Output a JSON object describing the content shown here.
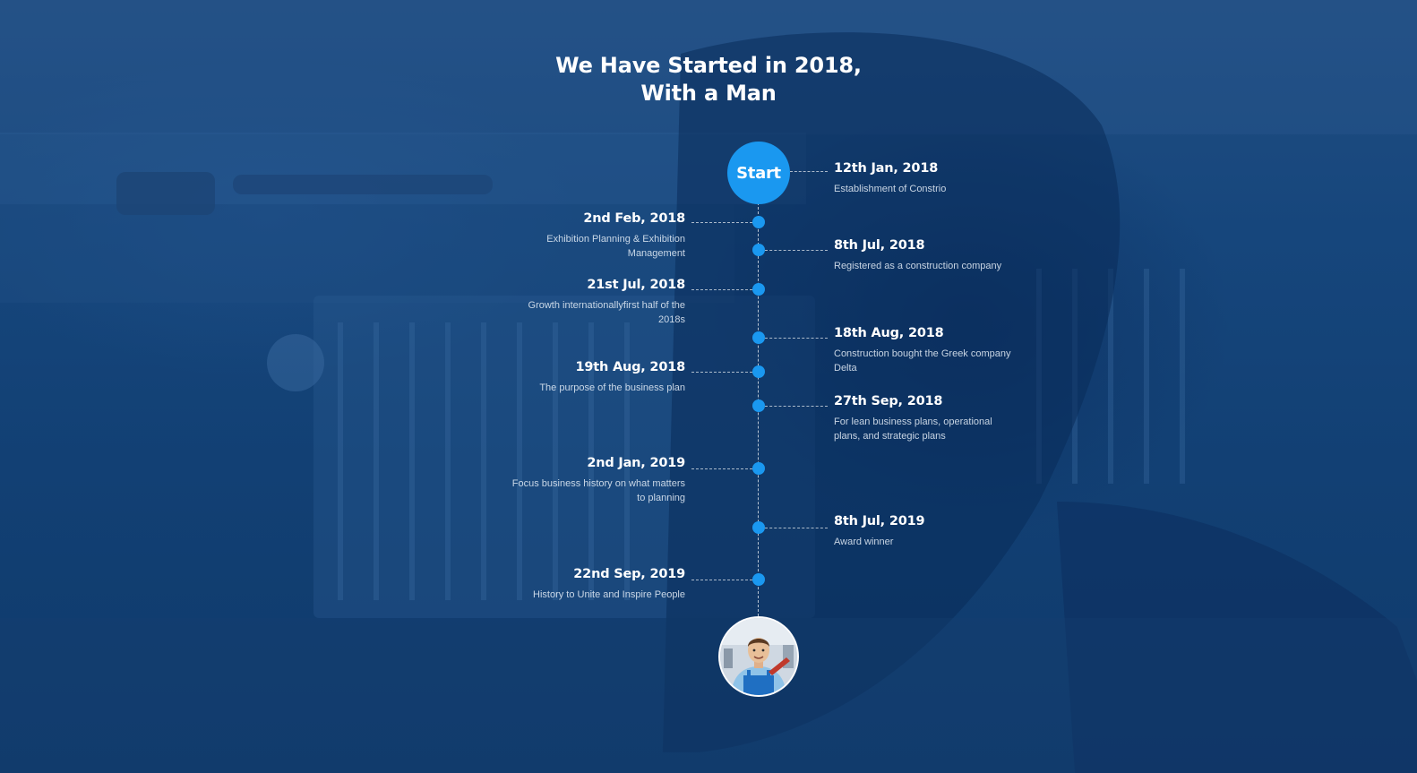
{
  "heading": {
    "line1": "We Have Started in 2018,",
    "line2": "With a Man"
  },
  "start": {
    "label": "Start",
    "date": "12th Jan, 2018",
    "desc": "Establishment of Constrio"
  },
  "timeline": [
    {
      "side": "left",
      "date": "2nd Feb, 2018",
      "desc": "Exhibition Planning & Exhibition Management"
    },
    {
      "side": "right",
      "date": "8th Jul, 2018",
      "desc": "Registered as a construction company"
    },
    {
      "side": "left",
      "date": "21st Jul, 2018",
      "desc": "Growth internationallyfirst half of the 2018s"
    },
    {
      "side": "right",
      "date": "18th Aug, 2018",
      "desc": "Construction bought the Greek company Delta"
    },
    {
      "side": "left",
      "date": "19th Aug, 2018",
      "desc": "The purpose of the business plan"
    },
    {
      "side": "right",
      "date": "27th Sep, 2018",
      "desc": "For lean business plans, operational plans, and strategic plans"
    },
    {
      "side": "left",
      "date": "2nd Jan, 2019",
      "desc": "Focus business history on what matters to planning"
    },
    {
      "side": "right",
      "date": "8th Jul, 2019",
      "desc": "Award winner"
    },
    {
      "side": "left",
      "date": "22nd Sep, 2019",
      "desc": "History to Unite and Inspire People"
    }
  ],
  "colors": {
    "accent": "#1a98f0",
    "overlay": "#0f3a6b"
  },
  "icons": {
    "avatar": "worker-portrait-icon"
  }
}
